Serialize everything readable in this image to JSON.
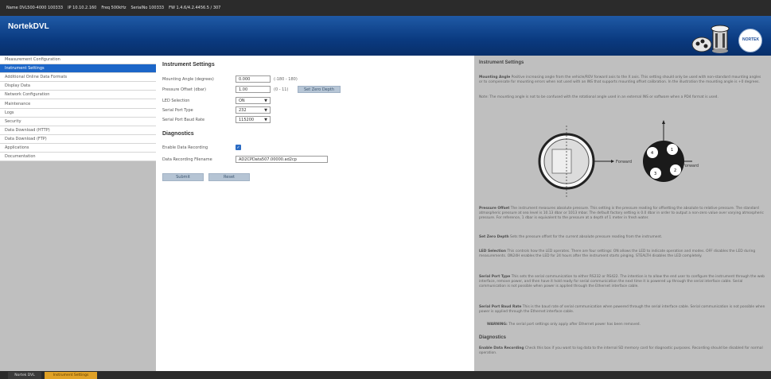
{
  "topbar": {
    "items": [
      "Name DVL500-4000 100333",
      "IP 10.10.2.160",
      "Freq 500kHz",
      "SerialNo 100333",
      "FW 1.4.6/4.2.4456.5 / 307"
    ]
  },
  "header": {
    "brand": "NortekDVL",
    "badge": "NORTEK"
  },
  "sidebar": {
    "items": [
      {
        "label": "Measurement Configuration",
        "active": false
      },
      {
        "label": "Instrument Settings",
        "active": true
      },
      {
        "label": "Additional Online Data Formats",
        "active": false
      },
      {
        "label": "Display Data",
        "active": false
      },
      {
        "label": "Network Configuration",
        "active": false
      },
      {
        "label": "Maintenance",
        "active": false
      },
      {
        "label": "Logs",
        "active": false
      },
      {
        "label": "Security",
        "active": false
      },
      {
        "label": "Data Download (HTTP)",
        "active": false
      },
      {
        "label": "Data Download (FTP)",
        "active": false
      },
      {
        "label": "Applications",
        "active": false
      },
      {
        "label": "Documentation",
        "active": false
      }
    ]
  },
  "form": {
    "section_title": "Instrument Settings",
    "mounting_angle": {
      "label": "Mounting Angle (degrees)",
      "value": "0.000",
      "range": "(-180 - 180)"
    },
    "pressure_offset": {
      "label": "Pressure Offset (dbar)",
      "value": "1.00",
      "range": "(0 - 11)",
      "button": "Set Zero Depth"
    },
    "led_selection": {
      "label": "LED Selection",
      "value": "ON"
    },
    "serial_port_type": {
      "label": "Serial Port Type",
      "value": "232"
    },
    "serial_baud_rate": {
      "label": "Serial Port Baud Rate",
      "value": "115200"
    },
    "diagnostics_title": "Diagnostics",
    "enable_recording": {
      "label": "Enable Data Recording",
      "checked": true
    },
    "recording_filename": {
      "label": "Data Recording Filename",
      "value": "AD2CPData507.00000.ad2cp"
    },
    "submit_label": "Submit",
    "reset_label": "Reset"
  },
  "help": {
    "title": "Instrument Settings",
    "p1_head": "Mounting Angle",
    "p1": "Positive increasing angle from the vehicle/ROV forward axis to the X axis. This setting should only be used with non-standard mounting angles or to compensate for mounting errors when not used with an INS that supports mounting offset calibration. In the illustration the mounting angle is +0 degrees.",
    "p2": "Note: The mounting angle is not to be confused with the rotational angle used in an external INS or software when a PD4 format is used.",
    "p3_head": "Pressure Offset",
    "p3": "The instrument measures absolute pressure. This setting is the pressure reading for offsetting the absolute to relative pressure. The standard atmospheric pressure at sea level is 10.13 dbar or 1013 mbar. The default factory setting is 0.0 dbar in order to output a non-zero value over varying atmospheric pressure. For reference, 1 dbar is equivalent to the pressure at a depth of 1 meter in fresh water.",
    "p4_head": "Set Zero Depth",
    "p4": "Sets the pressure offset for the current absolute pressure reading from the instrument.",
    "p5_head": "LED Selection",
    "p5": "This controls how the LED operates. There are four settings: ON allows the LED to indicate operation and modes. OFF disables the LED during measurements. ON24H enables the LED for 24 hours after the instrument starts pinging. STEALTH disables the LED completely.",
    "p6_head": "Serial Port Type",
    "p6": "This sets the serial communication to either RS232 or RS422. The intention is to allow the end user to configure the instrument through the web interface, remove power, and then have it hold ready for serial communication the next time it is powered up through the serial interface cable. Serial communication is not possible when power is applied through the Ethernet interface cable.",
    "p7_head": "Serial Port Baud Rate",
    "p7": "This is the baud rate of serial communication when powered through the serial interface cable. Serial communication is not possible when power is applied through the Ethernet interface cable.",
    "warning_head": "WARNING:",
    "warning": "The serial port settings only apply after Ethernet power has been removed.",
    "diag_title": "Diagnostics",
    "p8_head": "Enable Data Recording",
    "p8": "Check this box if you want to log data to the internal SD memory card for diagnostic purposes. Recording should be disabled for normal operation.",
    "forward_label_1": "Forward",
    "forward_label_2": "Forward",
    "beam_labels": [
      "1",
      "2",
      "3",
      "4"
    ]
  },
  "statusbar": {
    "tab1": "Nortek DVL",
    "tab2": "Instrument Settings"
  },
  "colors": {
    "header_blue": "#0a3a80",
    "active_nav": "#1c66c8",
    "status_accent": "#e0a126"
  }
}
